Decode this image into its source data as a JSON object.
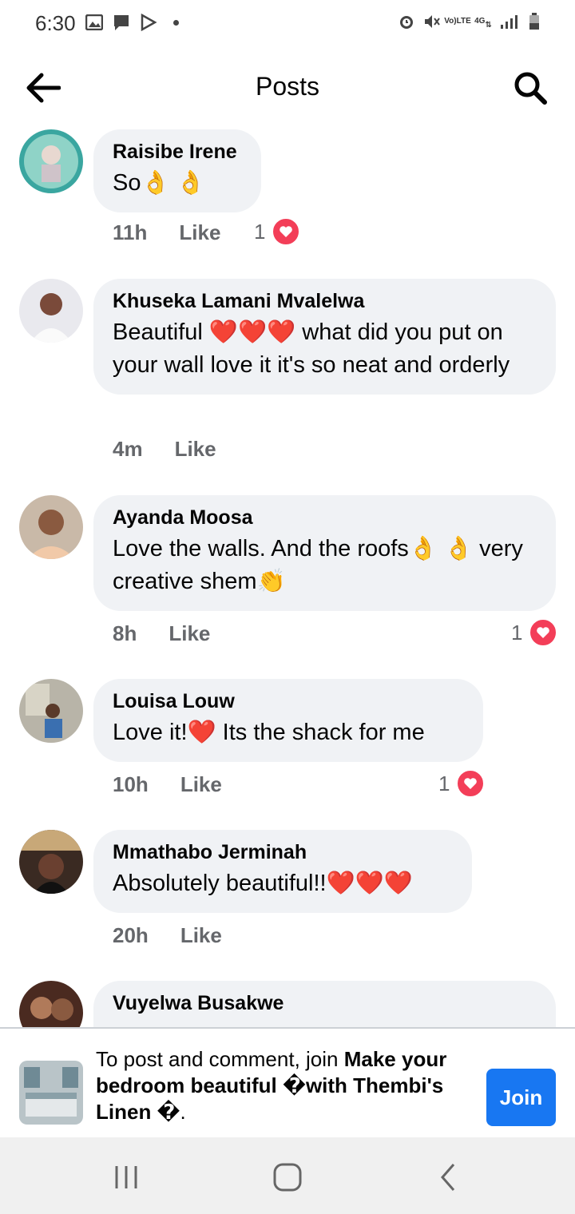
{
  "status": {
    "time": "6:30",
    "lte_top": "Vo)",
    "lte_bottom": "LTE",
    "network": "4G"
  },
  "header": {
    "title": "Posts"
  },
  "comments": [
    {
      "author": "Raisibe Irene",
      "text": "So👌 👌",
      "time": "11h",
      "like": "Like",
      "reactions": "1"
    },
    {
      "author": "Khuseka Lamani Mvalelwa",
      "text": "Beautiful ❤️❤️❤️ what did you put on your wall love it it's so neat and orderly",
      "time": "4m",
      "like": "Like",
      "reactions": ""
    },
    {
      "author": "Ayanda Moosa",
      "text": "Love the walls. And the roofs👌 👌 very creative shem👏",
      "time": "8h",
      "like": "Like",
      "reactions": "1"
    },
    {
      "author": "Louisa Louw",
      "text": "Love it!❤️ Its the shack for me",
      "time": "10h",
      "like": "Like",
      "reactions": "1"
    },
    {
      "author": "Mmathabo Jerminah",
      "text": "Absolutely beautiful!!❤️❤️❤️",
      "time": "20h",
      "like": "Like",
      "reactions": ""
    },
    {
      "author": "Vuyelwa Busakwe",
      "text": "",
      "time": "",
      "like": "",
      "reactions": ""
    }
  ],
  "joinbar": {
    "prefix": "To post and comment, join ",
    "group_name": "Make your bedroom beautiful �with Thembi's Linen �",
    "suffix": ".",
    "button": "Join"
  },
  "colors": {
    "accent": "#1877f2",
    "heart": "#f33e58",
    "bubble": "#f0f2f5",
    "meta": "#65676b"
  }
}
